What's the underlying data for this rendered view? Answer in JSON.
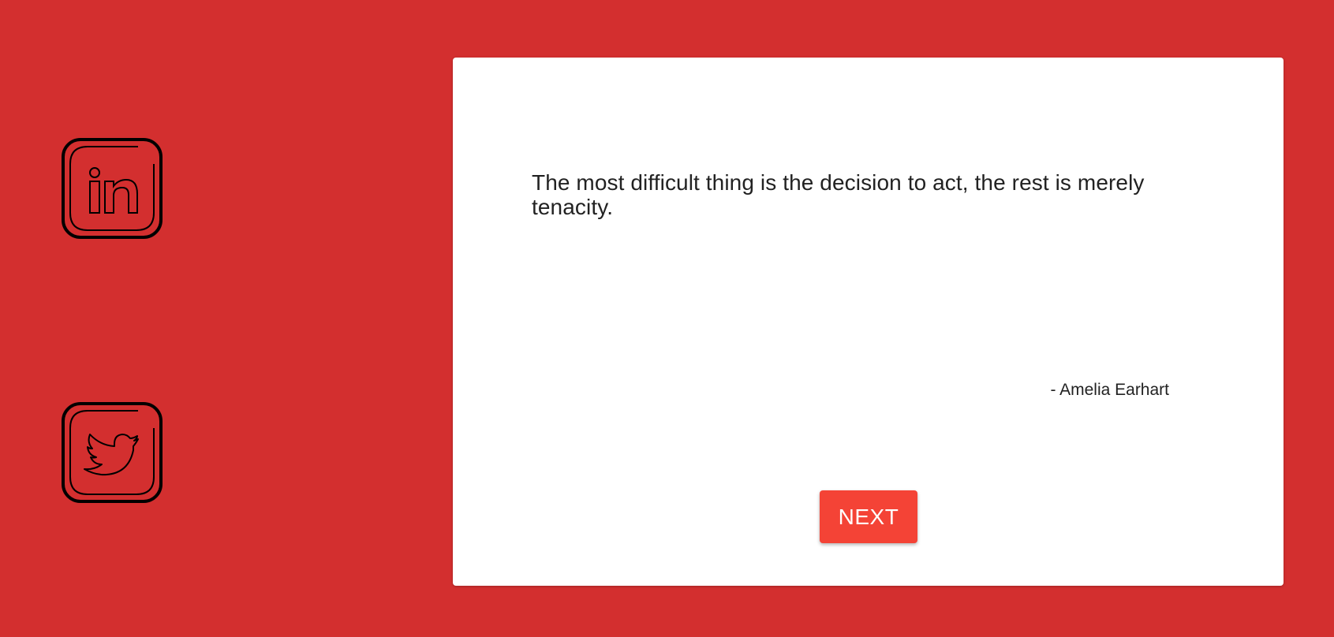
{
  "social": {
    "linkedin_icon": "linkedin-icon",
    "twitter_icon": "twitter-icon"
  },
  "quote": {
    "text": "The most difficult thing is the decision to act, the rest is merely tenacity.",
    "author": "- Amelia Earhart"
  },
  "actions": {
    "next_label": "NEXT"
  },
  "colors": {
    "background": "#d32f2f",
    "card": "#ffffff",
    "button": "#f44336",
    "text": "#222222",
    "icon_stroke": "#000000"
  }
}
